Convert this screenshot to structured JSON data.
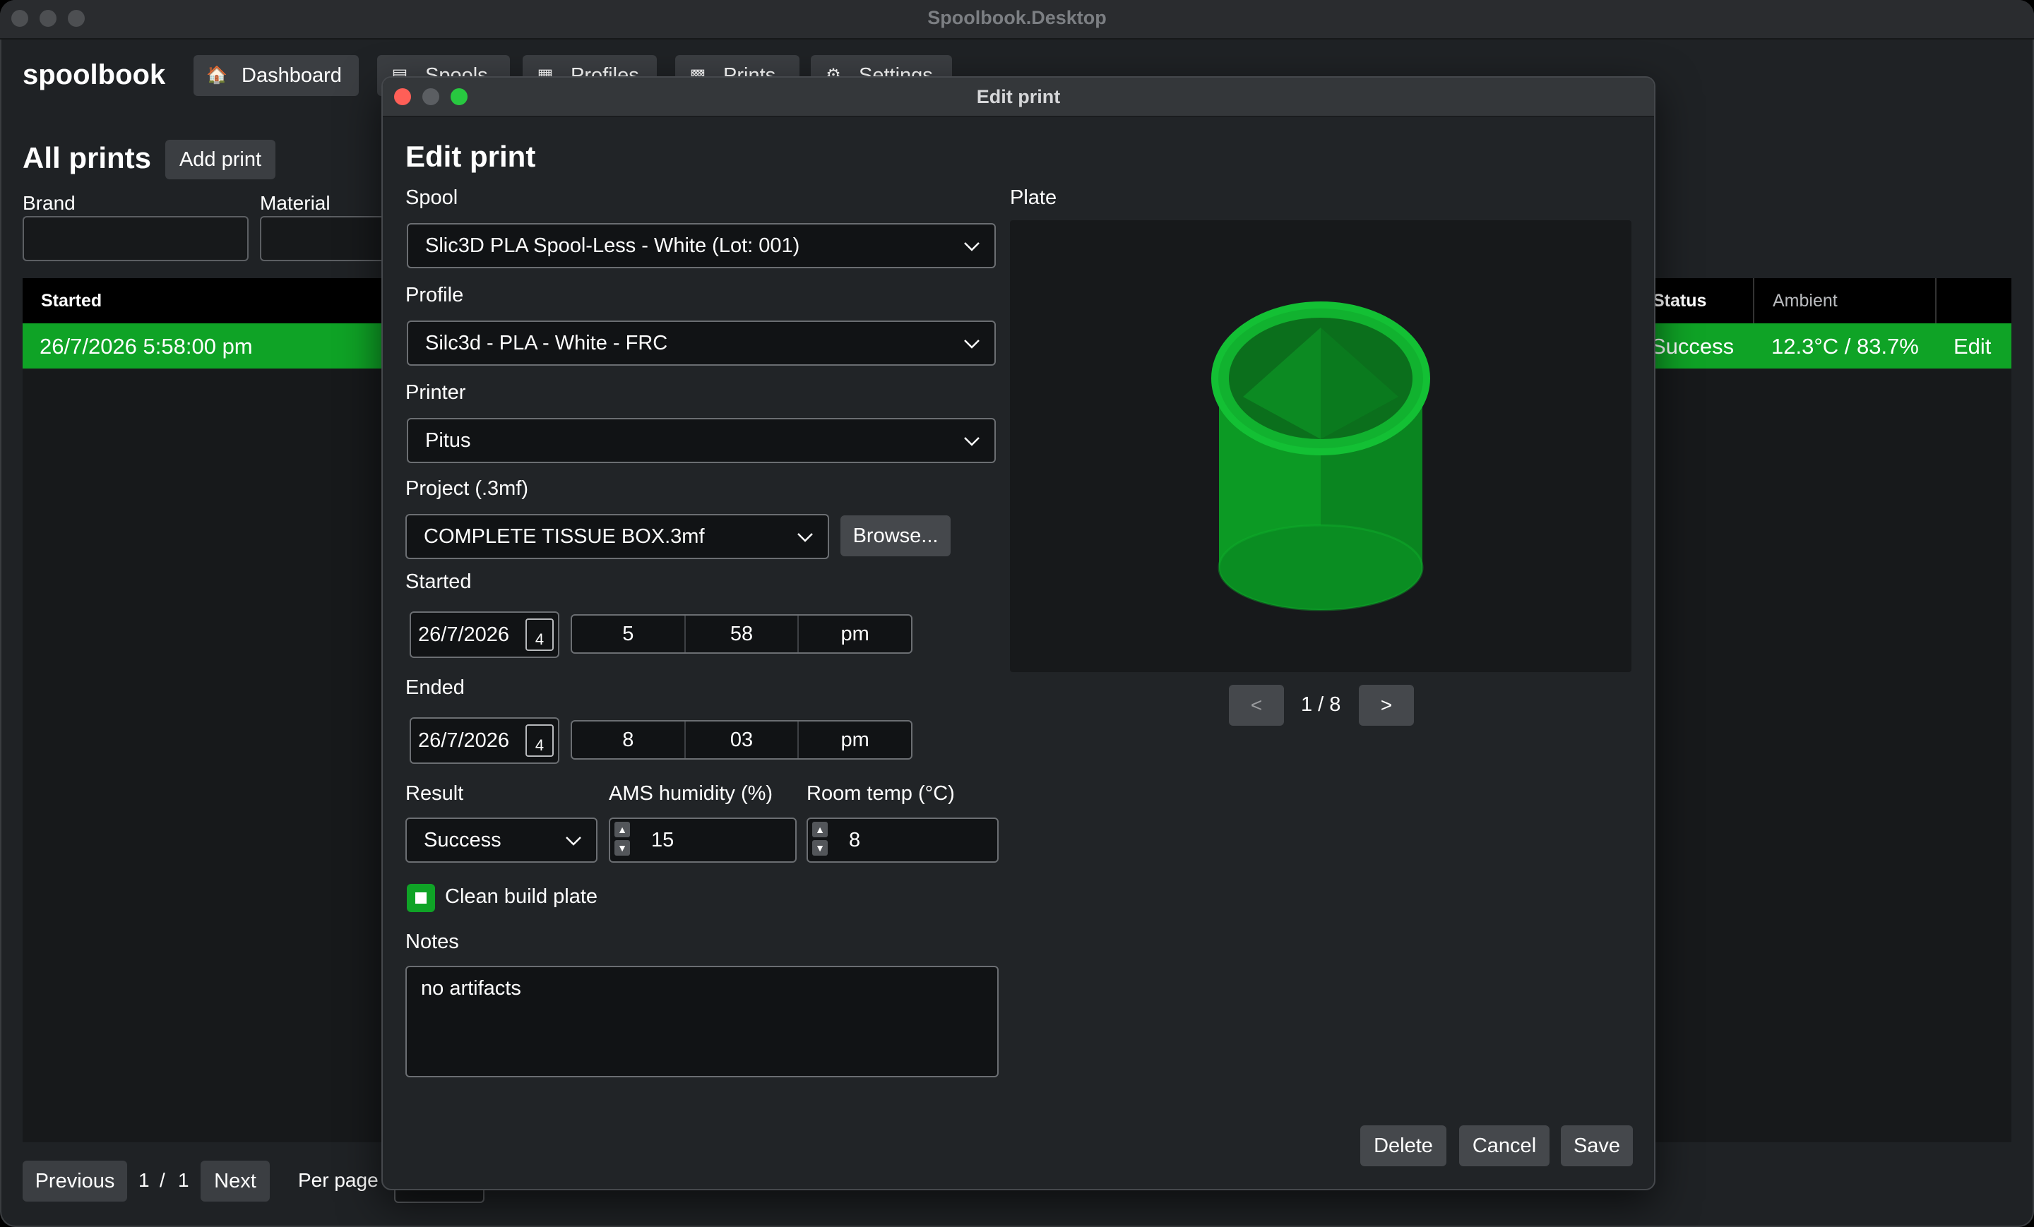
{
  "window": {
    "title": "Spoolbook.Desktop"
  },
  "app": {
    "brand": "spoolbook",
    "nav": [
      {
        "label": "Dashboard",
        "icon": "house-icon"
      },
      {
        "label": "Spools",
        "icon": "spool-icon"
      },
      {
        "label": "Profiles",
        "icon": "clipboard-icon"
      },
      {
        "label": "Prints",
        "icon": "printer-icon"
      },
      {
        "label": "Settings",
        "icon": "gear-icon"
      }
    ]
  },
  "page": {
    "title": "All prints",
    "add_label": "Add print",
    "filters": {
      "brand_label": "Brand",
      "material_label": "Material"
    },
    "table": {
      "headers": {
        "started": "Started",
        "status": "Status",
        "ambient": "Ambient"
      },
      "rows": [
        {
          "started": "26/7/2026 5:58:00 pm",
          "status": "Success",
          "ambient": "12.3°C / 83.7%",
          "edit": "Edit"
        }
      ]
    },
    "pager": {
      "previous": "Previous",
      "current": "1",
      "sep": "/",
      "total": "1",
      "next": "Next",
      "per_page_label": "Per page"
    }
  },
  "dialog": {
    "window_title": "Edit print",
    "heading": "Edit print",
    "spool": {
      "label": "Spool",
      "value": "Slic3D PLA Spool-Less - White (Lot: 001)"
    },
    "profile": {
      "label": "Profile",
      "value": "Silc3d - PLA - White - FRC"
    },
    "printer": {
      "label": "Printer",
      "value": "Pitus"
    },
    "project": {
      "label": "Project (.3mf)",
      "value": "COMPLETE TISSUE BOX.3mf",
      "browse": "Browse..."
    },
    "started": {
      "label": "Started",
      "date": "26/7/2026",
      "cal_day": "4",
      "hour": "5",
      "minute": "58",
      "ampm": "pm"
    },
    "ended": {
      "label": "Ended",
      "date": "26/7/2026",
      "cal_day": "4",
      "hour": "8",
      "minute": "03",
      "ampm": "pm"
    },
    "result": {
      "label": "Result",
      "value": "Success"
    },
    "ams_humidity": {
      "label": "AMS humidity (%)",
      "value": "15"
    },
    "room_temp": {
      "label": "Room temp (°C)",
      "value": "8"
    },
    "clean_plate": {
      "label": "Clean build plate",
      "checked": true
    },
    "notes": {
      "label": "Notes",
      "value": "no artifacts"
    },
    "plate": {
      "label": "Plate",
      "prev": "<",
      "next": ">",
      "indicator": "1 / 8"
    },
    "actions": {
      "delete": "Delete",
      "cancel": "Cancel",
      "save": "Save"
    },
    "colors": {
      "accent": "#0fa326",
      "model": "#0c9a24"
    }
  }
}
